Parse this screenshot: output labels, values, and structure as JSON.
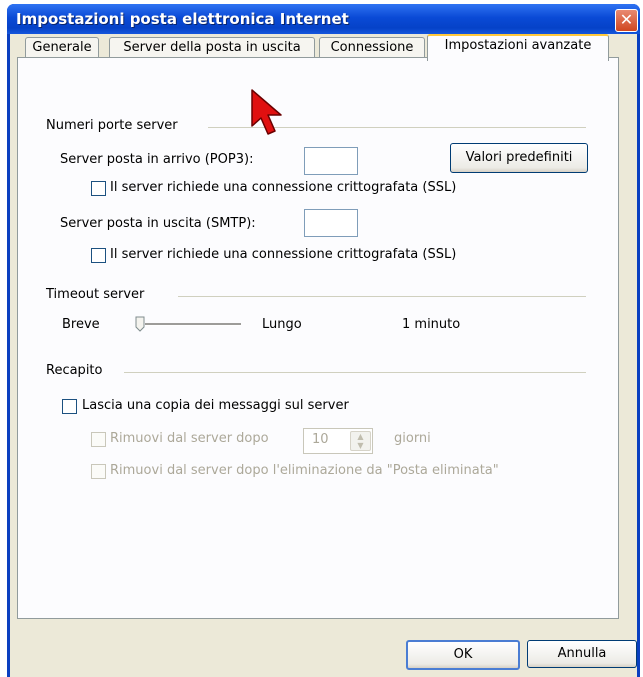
{
  "window": {
    "title": "Impostazioni posta elettronica Internet",
    "close_glyph": "✕"
  },
  "tabs": [
    {
      "label": "Generale"
    },
    {
      "label": "Server della posta in uscita"
    },
    {
      "label": "Connessione"
    },
    {
      "label": "Impostazioni avanzate"
    }
  ],
  "ports": {
    "group_label": "Numeri porte server",
    "incoming_label": "Server posta in arrivo (POP3):",
    "incoming_value": "",
    "incoming_ssl_label": "Il server richiede una connessione crittografata (SSL)",
    "outgoing_label": "Server posta in uscita (SMTP):",
    "outgoing_value": "",
    "outgoing_ssl_label": "Il server richiede una connessione crittografata (SSL)",
    "defaults_button": "Valori predefiniti"
  },
  "timeout": {
    "group_label": "Timeout server",
    "short_label": "Breve",
    "long_label": "Lungo",
    "value_label": "1 minuto",
    "slider_level": 0
  },
  "delivery": {
    "group_label": "Recapito",
    "keep_copy_label": "Lascia una copia dei messaggi sul server",
    "remove_after_label": "Rimuovi dal server dopo",
    "days_value": "10",
    "days_label": "giorni",
    "remove_deleted_label": "Rimuovi dal server dopo l'eliminazione da \"Posta eliminata\""
  },
  "buttons": {
    "ok": "OK",
    "cancel": "Annulla"
  },
  "colors": {
    "titlebar": "#0a4ad6",
    "tab_highlight": "#ffc83c",
    "dialog_bg": "#ece9d8"
  }
}
